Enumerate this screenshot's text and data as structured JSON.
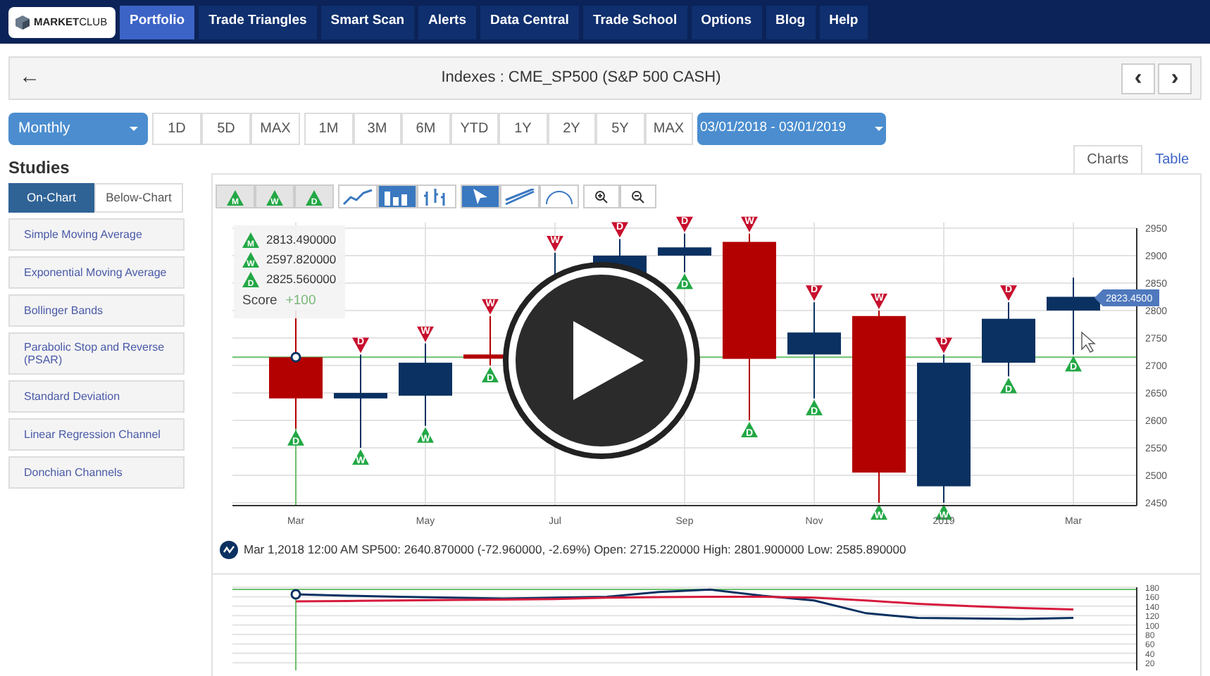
{
  "nav": {
    "logo_bold": "MARKET",
    "logo_light": "CLUB",
    "items": [
      {
        "label": "Portfolio",
        "selected": true
      },
      {
        "label": "Trade Triangles",
        "selected": false
      },
      {
        "label": "Smart Scan",
        "selected": false
      },
      {
        "label": "Alerts",
        "selected": false
      },
      {
        "label": "Data Central",
        "selected": false
      },
      {
        "label": "Trade School",
        "selected": false
      },
      {
        "label": "Options",
        "selected": false
      },
      {
        "label": "Blog",
        "selected": false
      },
      {
        "label": "Help",
        "selected": false
      }
    ]
  },
  "title_bar": {
    "back": "←",
    "title": "Indexes : CME_SP500 (S&P 500 CASH)",
    "prev": "‹",
    "next": "›"
  },
  "range": {
    "interval": "Monthly",
    "group_1": [
      "1D",
      "5D",
      "MAX"
    ],
    "group_2": [
      "1M",
      "3M",
      "6M",
      "YTD",
      "1Y",
      "2Y",
      "5Y",
      "MAX"
    ],
    "date_range": "03/01/2018 - 03/01/2019"
  },
  "studies": {
    "title": "Studies",
    "tabs": [
      {
        "label": "On-Chart",
        "selected": true
      },
      {
        "label": "Below-Chart",
        "selected": false
      }
    ],
    "items": [
      "Simple Moving Average",
      "Exponential Moving Average",
      "Bollinger Bands",
      "Parabolic Stop and Reverse (PSAR)",
      "Standard Deviation",
      "Linear Regression Channel",
      "Donchian Channels"
    ]
  },
  "view_tabs": [
    {
      "label": "Charts",
      "selected": true
    },
    {
      "label": "Table",
      "selected": false
    }
  ],
  "toolbar": {
    "signals": [
      "M",
      "W",
      "D"
    ],
    "chart_types": [
      {
        "kind": "line",
        "selected": false
      },
      {
        "kind": "candle",
        "selected": true
      },
      {
        "kind": "ohlc",
        "selected": false
      }
    ],
    "tools": [
      {
        "kind": "cursor",
        "selected": true
      },
      {
        "kind": "trendline",
        "selected": false
      },
      {
        "kind": "fib",
        "selected": false
      }
    ]
  },
  "legend": {
    "rows": [
      {
        "signal": "M",
        "value": "2813.490000"
      },
      {
        "signal": "W",
        "value": "2597.820000"
      },
      {
        "signal": "D",
        "value": "2825.560000"
      }
    ],
    "score_label": "Score",
    "score": "+100"
  },
  "candles": [
    {
      "bottom": "D"
    },
    {
      "top": "D",
      "bottom": "W"
    },
    {
      "top": "W",
      "bottom": "W"
    },
    {
      "top": "W",
      "bottom": "D"
    },
    {
      "top": "W"
    },
    {
      "top": "D"
    },
    {
      "top": "D",
      "bottom": "D"
    },
    {
      "top": "W",
      "bottom": "D"
    },
    {
      "top": "D",
      "bottom": "D"
    },
    {
      "top": "W",
      "bottom": "W"
    },
    {
      "top": "D",
      "bottom": "W"
    },
    {
      "top": "D",
      "bottom": "D"
    },
    {
      "bottom": "D"
    }
  ],
  "x_labels": [
    "Mar",
    "May",
    "Jul",
    "Sep",
    "Nov",
    "2019",
    "Mar"
  ],
  "y_ticks": [
    "2950",
    "2900",
    "2850",
    "2800",
    "2750",
    "2700",
    "2650",
    "2600",
    "2550",
    "2500",
    "2450"
  ],
  "price_tag": "2823.4500",
  "info_line": "Mar 1,2018 12:00 AM SP500: 2640.870000 (-72.960000, -2.69%) Open: 2715.220000 High: 2801.900000 Low: 2585.890000",
  "lower_chart": {
    "chart_data": {
      "type": "line",
      "grid": true,
      "ylim": [
        20,
        180
      ],
      "yticks": [
        180,
        160,
        140,
        120,
        100,
        80,
        60,
        40,
        20
      ],
      "series": [
        {
          "color": "#0a3161",
          "values": [
            165,
            162,
            160,
            158,
            156,
            158,
            160,
            170,
            175,
            162,
            152,
            125,
            115,
            114,
            113,
            115
          ]
        },
        {
          "color": "#d61a3c",
          "values": [
            150,
            151,
            152,
            153,
            154,
            155,
            158,
            159,
            160,
            160,
            158,
            152,
            145,
            140,
            136,
            133
          ]
        }
      ]
    }
  }
}
